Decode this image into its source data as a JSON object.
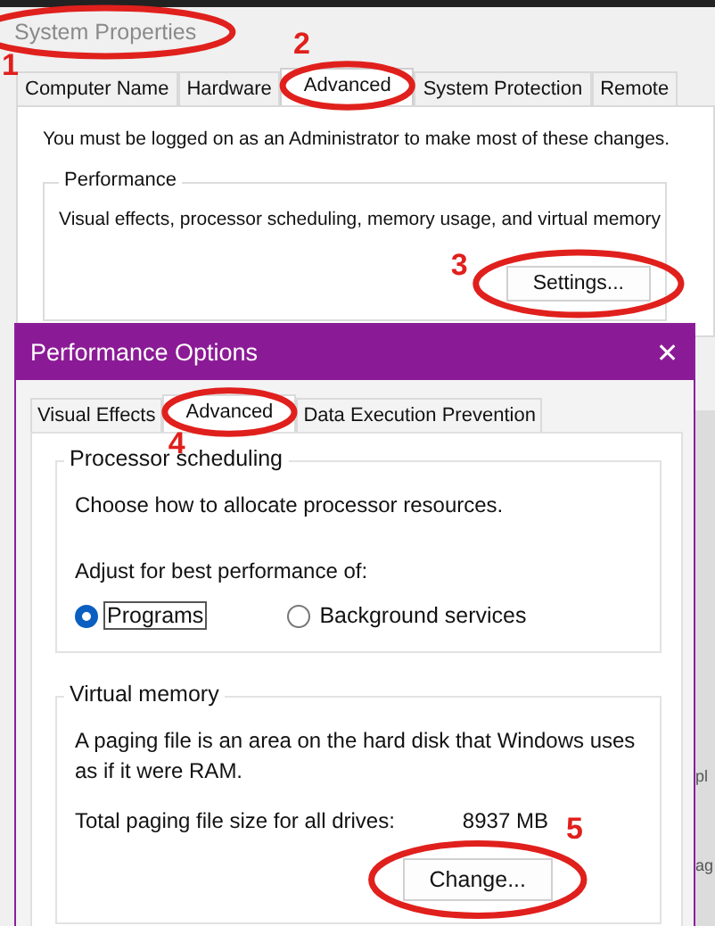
{
  "system_properties": {
    "title": "System Properties",
    "tabs": [
      {
        "label": "Computer Name",
        "selected": false
      },
      {
        "label": "Hardware",
        "selected": false
      },
      {
        "label": "Advanced",
        "selected": true
      },
      {
        "label": "System Protection",
        "selected": false
      },
      {
        "label": "Remote",
        "selected": false
      }
    ],
    "notice": "You must be logged on as an Administrator to make most of these changes.",
    "performance": {
      "heading": "Performance",
      "description": "Visual effects, processor scheduling, memory usage, and virtual memory",
      "button": "Settings..."
    },
    "background_fragments": [
      "pl",
      "ag"
    ]
  },
  "performance_options": {
    "title": "Performance Options",
    "close": "✕",
    "tabs": [
      {
        "label": "Visual Effects",
        "selected": false
      },
      {
        "label": "Advanced",
        "selected": true
      },
      {
        "label": "Data Execution Prevention",
        "selected": false
      }
    ],
    "processor_scheduling": {
      "heading": "Processor scheduling",
      "description": "Choose how to allocate processor resources.",
      "prompt": "Adjust for best performance of:",
      "options": [
        {
          "label": "Programs",
          "selected": true
        },
        {
          "label": "Background services",
          "selected": false
        }
      ]
    },
    "virtual_memory": {
      "heading": "Virtual memory",
      "description": "A paging file is an area on the hard disk that Windows uses as if it were RAM.",
      "size_label": "Total paging file size for all drives:",
      "size_value": "8937 MB",
      "button": "Change..."
    }
  },
  "annotations": [
    {
      "number": "1"
    },
    {
      "number": "2"
    },
    {
      "number": "3"
    },
    {
      "number": "4"
    },
    {
      "number": "5"
    }
  ]
}
